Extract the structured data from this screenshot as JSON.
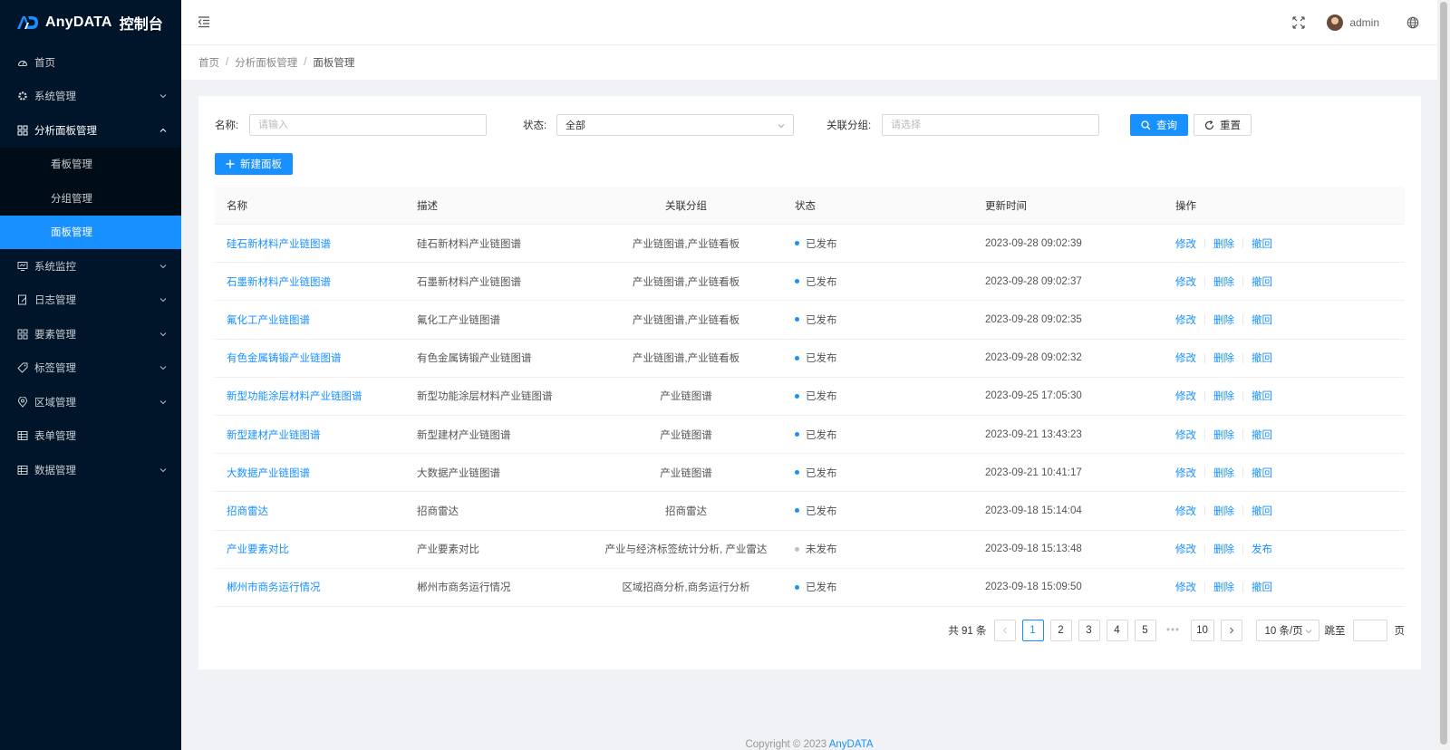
{
  "app": {
    "logo_text": "AnyDATA",
    "logo_sub": "控制台",
    "colors": {
      "sidebar_bg": "#001529",
      "submenu_bg": "#000c17",
      "accent": "#1890ff"
    }
  },
  "sidebar": {
    "items": [
      {
        "label": "首页",
        "icon": "dashboard-icon",
        "has_children": false
      },
      {
        "label": "系统管理",
        "icon": "gear-icon",
        "has_children": true
      },
      {
        "label": "分析面板管理",
        "icon": "appstore-icon",
        "has_children": true,
        "open": true,
        "children": [
          {
            "label": "看板管理",
            "active": false
          },
          {
            "label": "分组管理",
            "active": false
          },
          {
            "label": "面板管理",
            "active": true
          }
        ]
      },
      {
        "label": "系统监控",
        "icon": "monitor-icon",
        "has_children": true
      },
      {
        "label": "日志管理",
        "icon": "file-edit-icon",
        "has_children": true
      },
      {
        "label": "要素管理",
        "icon": "grid-icon",
        "has_children": true
      },
      {
        "label": "标签管理",
        "icon": "tag-icon",
        "has_children": true
      },
      {
        "label": "区域管理",
        "icon": "location-icon",
        "has_children": true
      },
      {
        "label": "表单管理",
        "icon": "table-icon",
        "has_children": false
      },
      {
        "label": "数据管理",
        "icon": "table-icon",
        "has_children": true
      }
    ]
  },
  "header": {
    "user_name": "admin",
    "icons": [
      "menu-fold-icon",
      "fullscreen-icon",
      "globe-icon"
    ]
  },
  "breadcrumb": [
    "首页",
    "分析面板管理",
    "面板管理"
  ],
  "filters": {
    "name_label": "名称:",
    "name_placeholder": "请输入",
    "status_label": "状态:",
    "status_value": "全部",
    "group_label": "关联分组:",
    "group_placeholder": "请选择",
    "search_btn": "查询",
    "reset_btn": "重置"
  },
  "new_btn": "新建面板",
  "table": {
    "headers": [
      "名称",
      "描述",
      "关联分组",
      "状态",
      "更新时间",
      "操作"
    ],
    "rows": [
      {
        "name": "硅石新材料产业链图谱",
        "desc": "硅石新材料产业链图谱",
        "group": "产业链图谱,产业链看板",
        "status": "已发布",
        "published": true,
        "time": "2023-09-28 09:02:39",
        "ops": [
          "修改",
          "删除",
          "撤回"
        ]
      },
      {
        "name": "石墨新材料产业链图谱",
        "desc": "石墨新材料产业链图谱",
        "group": "产业链图谱,产业链看板",
        "status": "已发布",
        "published": true,
        "time": "2023-09-28 09:02:37",
        "ops": [
          "修改",
          "删除",
          "撤回"
        ]
      },
      {
        "name": "氟化工产业链图谱",
        "desc": "氟化工产业链图谱",
        "group": "产业链图谱,产业链看板",
        "status": "已发布",
        "published": true,
        "time": "2023-09-28 09:02:35",
        "ops": [
          "修改",
          "删除",
          "撤回"
        ]
      },
      {
        "name": "有色金属铸锻产业链图谱",
        "desc": "有色金属铸锻产业链图谱",
        "group": "产业链图谱,产业链看板",
        "status": "已发布",
        "published": true,
        "time": "2023-09-28 09:02:32",
        "ops": [
          "修改",
          "删除",
          "撤回"
        ]
      },
      {
        "name": "新型功能涂层材料产业链图谱",
        "desc": "新型功能涂层材料产业链图谱",
        "group": "产业链图谱",
        "status": "已发布",
        "published": true,
        "time": "2023-09-25 17:05:30",
        "ops": [
          "修改",
          "删除",
          "撤回"
        ]
      },
      {
        "name": "新型建材产业链图谱",
        "desc": "新型建材产业链图谱",
        "group": "产业链图谱",
        "status": "已发布",
        "published": true,
        "time": "2023-09-21 13:43:23",
        "ops": [
          "修改",
          "删除",
          "撤回"
        ]
      },
      {
        "name": "大数据产业链图谱",
        "desc": "大数据产业链图谱",
        "group": "产业链图谱",
        "status": "已发布",
        "published": true,
        "time": "2023-09-21 10:41:17",
        "ops": [
          "修改",
          "删除",
          "撤回"
        ]
      },
      {
        "name": "招商雷达",
        "desc": "招商雷达",
        "group": "招商雷达",
        "status": "已发布",
        "published": true,
        "time": "2023-09-18 15:14:04",
        "ops": [
          "修改",
          "删除",
          "撤回"
        ]
      },
      {
        "name": "产业要素对比",
        "desc": "产业要素对比",
        "group": "产业与经济标签统计分析, 产业雷达",
        "status": "未发布",
        "published": false,
        "time": "2023-09-18 15:13:48",
        "ops": [
          "修改",
          "删除",
          "发布"
        ]
      },
      {
        "name": "郴州市商务运行情况",
        "desc": "郴州市商务运行情况",
        "group": "区域招商分析,商务运行分析",
        "status": "已发布",
        "published": true,
        "time": "2023-09-18 15:09:50",
        "ops": [
          "修改",
          "删除",
          "撤回"
        ]
      }
    ]
  },
  "pagination": {
    "total_text": "共 91 条",
    "pages": [
      "1",
      "2",
      "3",
      "4",
      "5"
    ],
    "ellipsis": "•••",
    "last_page": "10",
    "current": "1",
    "page_size": "10 条/页",
    "jump_label": "跳至",
    "jump_suffix": "页"
  },
  "footer": {
    "copyright": "Copyright © 2023 ",
    "brand": "AnyDATA"
  }
}
